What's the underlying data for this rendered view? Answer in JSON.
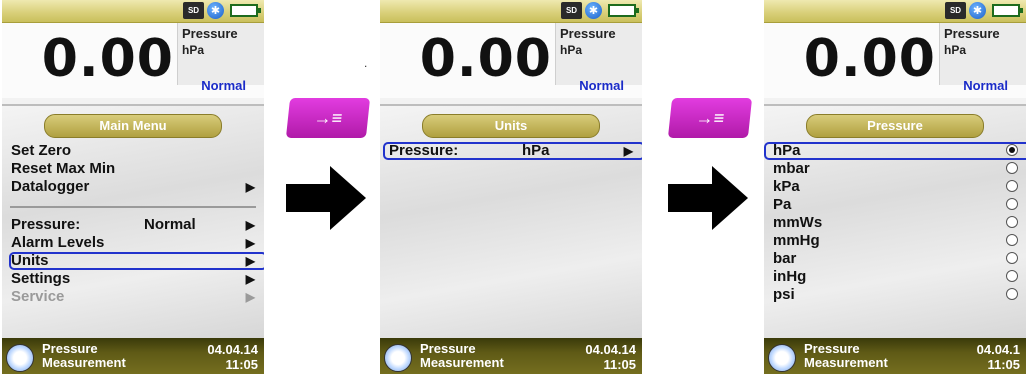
{
  "screens": [
    {
      "status": {
        "sd": "SD"
      },
      "reading": {
        "value": "0.00",
        "label": "Pressure",
        "unit": "hPa",
        "mode": "Normal"
      },
      "menu": {
        "title": "Main Menu",
        "items": [
          {
            "label": "Set Zero"
          },
          {
            "label": "Reset Max Min"
          },
          {
            "label": "Datalogger"
          },
          {
            "label": "Pressure:",
            "value": "Normal"
          },
          {
            "label": "Alarm Levels"
          },
          {
            "label": "Units"
          },
          {
            "label": "Settings"
          },
          {
            "label": "Service"
          }
        ]
      },
      "bottom": {
        "line1": "Pressure",
        "line2": "Measurement",
        "date": "04.04.14",
        "time": "11:05"
      }
    },
    {
      "status": {
        "sd": "SD"
      },
      "reading": {
        "value": "0.00",
        "label": "Pressure",
        "unit": "hPa",
        "mode": "Normal"
      },
      "menu": {
        "title": "Units",
        "items": [
          {
            "label": "Pressure:",
            "value": "hPa"
          }
        ]
      },
      "bottom": {
        "line1": "Pressure",
        "line2": "Measurement",
        "date": "04.04.14",
        "time": "11:05"
      }
    },
    {
      "status": {
        "sd": "SD"
      },
      "reading": {
        "value": "0.00",
        "label": "Pressure",
        "unit": "hPa",
        "mode": "Normal"
      },
      "menu": {
        "title": "Pressure",
        "items": [
          {
            "label": "hPa"
          },
          {
            "label": "mbar"
          },
          {
            "label": "kPa"
          },
          {
            "label": "Pa"
          },
          {
            "label": "mmWs"
          },
          {
            "label": "mmHg"
          },
          {
            "label": "bar"
          },
          {
            "label": "inHg"
          },
          {
            "label": "psi"
          }
        ]
      },
      "bottom": {
        "line1": "Pressure",
        "line2": "Measurement",
        "date": "04.04.1",
        "time": "11:05"
      }
    }
  ],
  "icons": {
    "enter_button": "enter-key-icon",
    "next_arrow": "right-arrow-icon",
    "bluetooth": "bluetooth-icon",
    "battery": "battery-icon",
    "gauge": "gauge-icon"
  },
  "colors": {
    "status_bar": "#d8cf78",
    "selection": "#2233cc",
    "mode_text": "#1a2bc8",
    "button": "#c82bc4",
    "bottom_bar": "#5f5a16"
  },
  "annotation": {
    "dot": "."
  }
}
